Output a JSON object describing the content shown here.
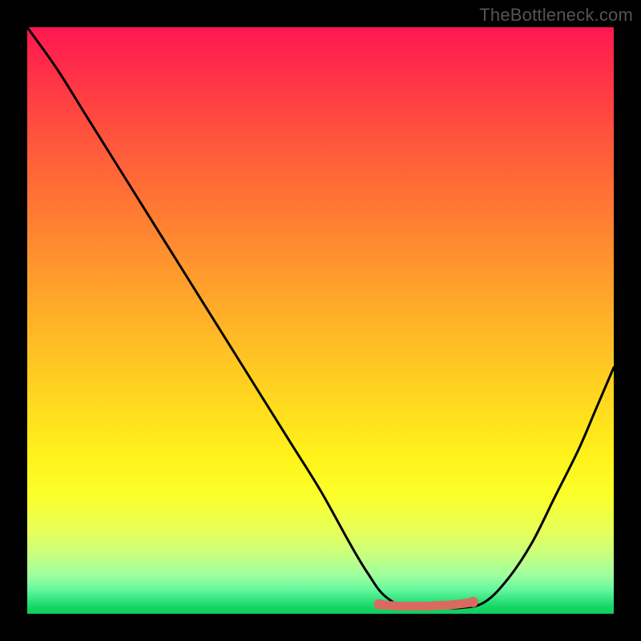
{
  "watermark": "TheBottleneck.com",
  "chart_data": {
    "type": "line",
    "title": "",
    "xlabel": "",
    "ylabel": "",
    "xlim": [
      0,
      1
    ],
    "ylim": [
      0,
      1
    ],
    "series": [
      {
        "name": "curve",
        "x": [
          0.0,
          0.05,
          0.1,
          0.15,
          0.2,
          0.25,
          0.3,
          0.35,
          0.4,
          0.45,
          0.5,
          0.55,
          0.58,
          0.61,
          0.65,
          0.7,
          0.74,
          0.78,
          0.82,
          0.86,
          0.9,
          0.94,
          0.97,
          1.0
        ],
        "y": [
          1.0,
          0.93,
          0.85,
          0.77,
          0.69,
          0.61,
          0.53,
          0.45,
          0.37,
          0.29,
          0.21,
          0.12,
          0.07,
          0.03,
          0.01,
          0.01,
          0.01,
          0.02,
          0.06,
          0.12,
          0.2,
          0.28,
          0.35,
          0.42
        ]
      },
      {
        "name": "highlight",
        "x": [
          0.6,
          0.62,
          0.64,
          0.66,
          0.68,
          0.7,
          0.72,
          0.74,
          0.76
        ],
        "y": [
          0.016,
          0.014,
          0.013,
          0.013,
          0.013,
          0.014,
          0.015,
          0.017,
          0.02
        ]
      }
    ],
    "colors": {
      "curve": "#000000",
      "highlight": "#d96a62",
      "gradient_top": "#ff1750",
      "gradient_mid": "#ffd420",
      "gradient_bottom": "#0fce5f"
    }
  }
}
